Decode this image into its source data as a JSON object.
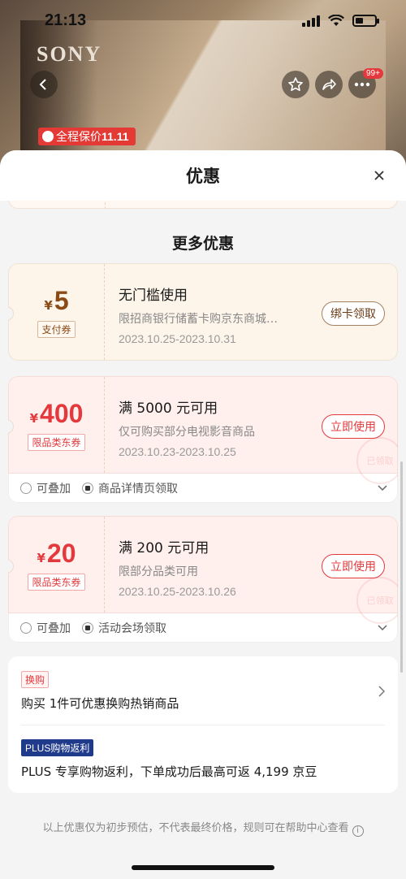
{
  "status_bar": {
    "time": "21:13"
  },
  "backdrop": {
    "brand": "SONY",
    "more_badge": "99+",
    "promo_tag": "全程保价",
    "promo_tag_extra": "11.11"
  },
  "sheet": {
    "title": "优惠",
    "section_title": "更多优惠",
    "coupons": [
      {
        "currency": "¥",
        "amount": "5",
        "type": "支付券",
        "title": "无门槛使用",
        "desc": "限招商银行储蓄卡购京东商城…",
        "date": "2023.10.25-2023.10.31",
        "button": "绑卡领取"
      },
      {
        "currency": "¥",
        "amount": "400",
        "type": "限品类东券",
        "title": "满 5000 元可用",
        "desc": "仅可购买部分电视影音商品",
        "date": "2023.10.23-2023.10.25",
        "button": "立即使用",
        "stamp": "已领取",
        "foot_stackable": "可叠加",
        "foot_source": "商品详情页领取"
      },
      {
        "currency": "¥",
        "amount": "20",
        "type": "限品类东券",
        "title": "满 200 元可用",
        "desc": "限部分品类可用",
        "date": "2023.10.25-2023.10.26",
        "button": "立即使用",
        "stamp": "已领取",
        "foot_stackable": "可叠加",
        "foot_source": "活动会场领取"
      }
    ],
    "promos": [
      {
        "tag": "换购",
        "text": "购买 1件可优惠换购热销商品"
      },
      {
        "tag": "PLUS购物返利",
        "text": "PLUS 专享购物返利，下单成功后最高可返 4,199 京豆"
      }
    ],
    "disclaimer": "以上优惠仅为初步预估，不代表最终价格，规则可在帮助中心查看",
    "info_icon_glyph": "i"
  },
  "colors": {
    "jd_red": "#e4393c",
    "coupon_brown": "#8a4b16",
    "plus_blue": "#1f3a8a"
  },
  "icons": [
    "back-arrow-icon",
    "star-icon",
    "share-icon",
    "more-dots-icon",
    "close-icon",
    "chevron-down-icon",
    "chevron-right-icon",
    "info-icon"
  ]
}
